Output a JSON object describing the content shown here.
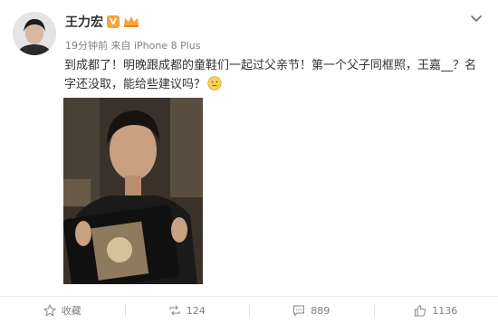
{
  "author": {
    "name": "王力宏",
    "vip_label": "V"
  },
  "meta": {
    "time_source": "19分钟前 来自 iPhone 8 Plus"
  },
  "post": {
    "text": "到成都了！明晚跟成都的童鞋们一起过父亲节！第一个父子同框照，王嘉__？名字还没取，能给些建议吗？",
    "emoji_icon": "thinking-emoji-icon"
  },
  "actions": {
    "favorite_label": "收藏",
    "repost_count": "124",
    "comment_count": "889",
    "like_count": "1136"
  },
  "colors": {
    "text": "#333333",
    "meta": "#808080",
    "vip_badge": "#f7a23b",
    "divider": "#ececec"
  }
}
